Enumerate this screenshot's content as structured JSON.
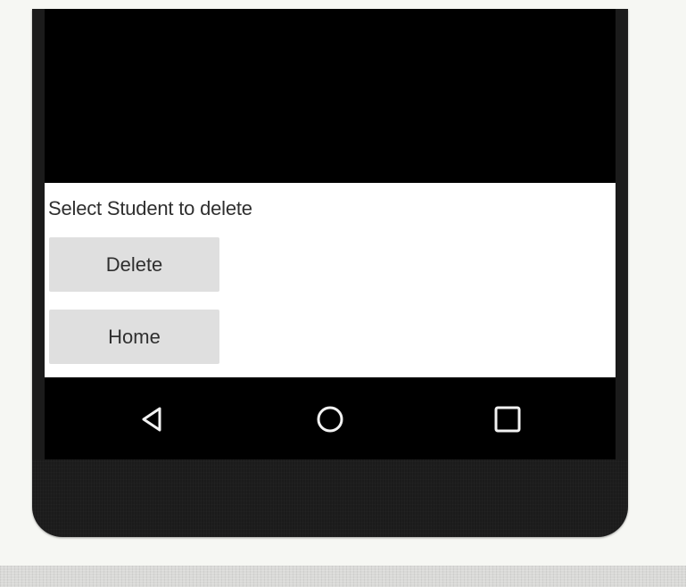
{
  "app": {
    "instruction_label": "Select Student to delete",
    "buttons": {
      "delete": "Delete",
      "home": "Home"
    }
  },
  "navigation": {
    "back_icon": "back-triangle-icon",
    "home_icon": "home-circle-icon",
    "recent_apps_icon": "recent-apps-square-icon"
  },
  "colors": {
    "screen_background": "#000000",
    "content_background": "#ffffff",
    "button_background": "#dfdfdf",
    "text": "#2f2f2f",
    "device_bezel": "#1b1b1b",
    "page_background": "#f6f7f3",
    "nav_icon": "#f2f2f2"
  }
}
